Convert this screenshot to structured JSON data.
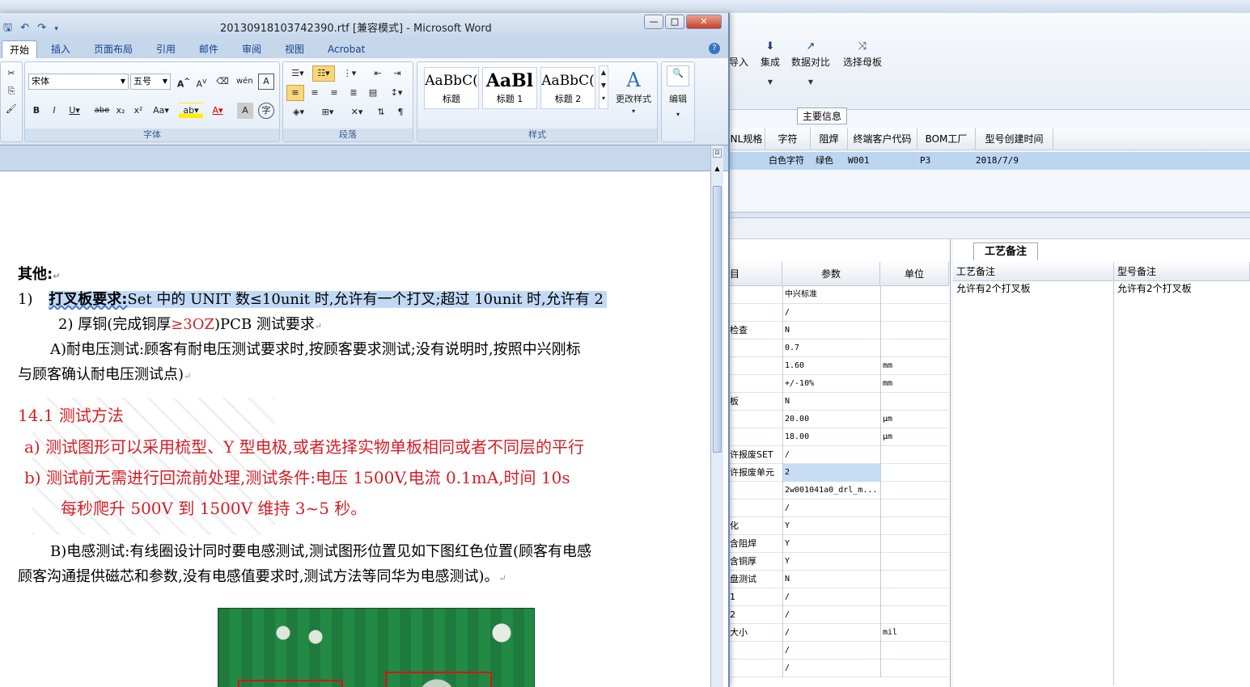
{
  "word": {
    "title": "20130918103742390.rtf [兼容模式] - Microsoft Word",
    "window_controls": {
      "minimize": "—",
      "maximize": "□",
      "close": "✕"
    },
    "tabs": [
      "开始",
      "插入",
      "页面布局",
      "引用",
      "邮件",
      "审阅",
      "视图",
      "Acrobat"
    ],
    "active_tab": "开始",
    "font": {
      "name": "宋体",
      "size": "五号",
      "group_label": "字体"
    },
    "paragraph_group_label": "段落",
    "styles": {
      "group_label": "样式",
      "items": [
        {
          "sample": "AaBbC(",
          "label": "标题"
        },
        {
          "sample": "AaBl",
          "label": "标题 1"
        },
        {
          "sample": "AaBbC(",
          "label": "标题 2"
        }
      ],
      "change_styles": "更改样式"
    },
    "edit_label": "编辑",
    "doc": {
      "heading_other": "其他:",
      "item1_num": "1)",
      "item1_bold": "打叉板要求:",
      "item1_text": "Set 中的 UNIT 数≤10unit 时,允许有一个打叉;超过 10unit 时,允许有 2",
      "item2_text": "2) 厚铜(完成铜厚",
      "item2_red": "≥3OZ",
      "item2_tail": ")PCB 测试要求",
      "pA_text": "A)耐电压测试:顾客有耐电压测试要求时,按顾客要求测试;没有说明时,按照中兴刚标",
      "pA_text2": "与顾客确认耐电压测试点)",
      "sec_heading": "14.1  测试方法",
      "sec_a": "a) 测试图形可以采用梳型、Y 型电极,或者选择实物单板相同或者不同层的平行",
      "sec_b": "b) 测试前无需进行回流前处理,测试条件:电压 1500V,电流 0.1mA,时间 10s",
      "sec_b2": "每秒爬升 500V 到 1500V 维持 3~5 秒。",
      "pB_text": "B)电感测试:有线圈设计同时要电感测试,测试图形位置见如下图红色位置(顾客有电感",
      "pB_text2": "顾客沟通提供磁芯和参数,没有电感值要求时,测试方法等同华为电感测试)。"
    }
  },
  "bg_app": {
    "toolbar": [
      {
        "icon": "",
        "label": "导入"
      },
      {
        "icon": "⬇",
        "label": "集成"
      },
      {
        "icon": "↗",
        "label": "数据对比"
      },
      {
        "icon": "⤨",
        "label": "选择母板"
      }
    ],
    "section_label": "主要信息",
    "grid_headers": [
      "NL规格",
      "字符",
      "阻焊",
      "终端客户代码",
      "BOM工厂",
      "型号创建时间"
    ],
    "grid_row": [
      "",
      "白色字符",
      "绿色",
      "W001",
      "P3",
      "2018/7/9"
    ],
    "param_headers": [
      "目",
      "参数",
      "单位"
    ],
    "params": [
      [
        "",
        "中兴标准",
        ""
      ],
      [
        "",
        "/",
        ""
      ],
      [
        "检查",
        "N",
        ""
      ],
      [
        "",
        "0.7",
        ""
      ],
      [
        "",
        "1.60",
        "mm"
      ],
      [
        "",
        "+/-10%",
        "mm"
      ],
      [
        "板",
        "N",
        ""
      ],
      [
        "",
        "20.00",
        "μm"
      ],
      [
        "",
        "18.00",
        "μm"
      ],
      [
        "许报废SET",
        "/",
        ""
      ],
      [
        "许报废单元",
        "2",
        ""
      ],
      [
        "",
        "2w001041a0_drl_m...",
        ""
      ],
      [
        "",
        "/",
        ""
      ],
      [
        "化",
        "Y",
        ""
      ],
      [
        "含阻焊",
        "Y",
        ""
      ],
      [
        "含铜厚",
        "Y",
        ""
      ],
      [
        "盘测试",
        "N",
        ""
      ],
      [
        "1",
        "/",
        ""
      ],
      [
        "2",
        "/",
        ""
      ],
      [
        "大小",
        "/",
        "mil"
      ],
      [
        "",
        "/",
        ""
      ],
      [
        "",
        "/",
        ""
      ]
    ],
    "remark_tab": "工艺备注",
    "remark_headers": [
      "工艺备注",
      "型号备注"
    ],
    "remark_values": [
      "允许有2个打叉板",
      "允许有2个打叉板"
    ]
  }
}
